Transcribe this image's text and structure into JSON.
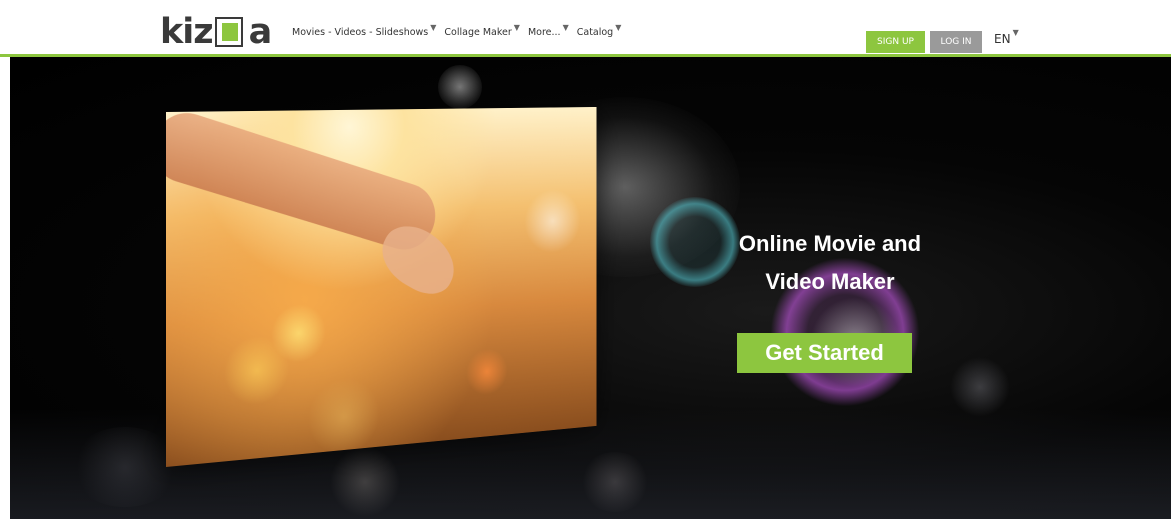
{
  "header": {
    "logo": "kizoa",
    "nav": [
      {
        "label": "Movies - Videos - Slideshows",
        "caret": "▼"
      },
      {
        "label": "Collage Maker",
        "caret": "▼"
      },
      {
        "label": "More...",
        "caret": "▼"
      },
      {
        "label": "Catalog",
        "caret": "▼"
      }
    ],
    "signup_label": "SIGN UP",
    "login_label": "LOG IN",
    "language": "EN",
    "language_caret": "▼"
  },
  "hero": {
    "title_line1": "Online Movie and",
    "title_line2": "Video Maker",
    "cta_label": "Get Started"
  },
  "colors": {
    "brand_green": "#8dc63f",
    "login_gray": "#9a9a9a",
    "hero_background": "#000000"
  }
}
